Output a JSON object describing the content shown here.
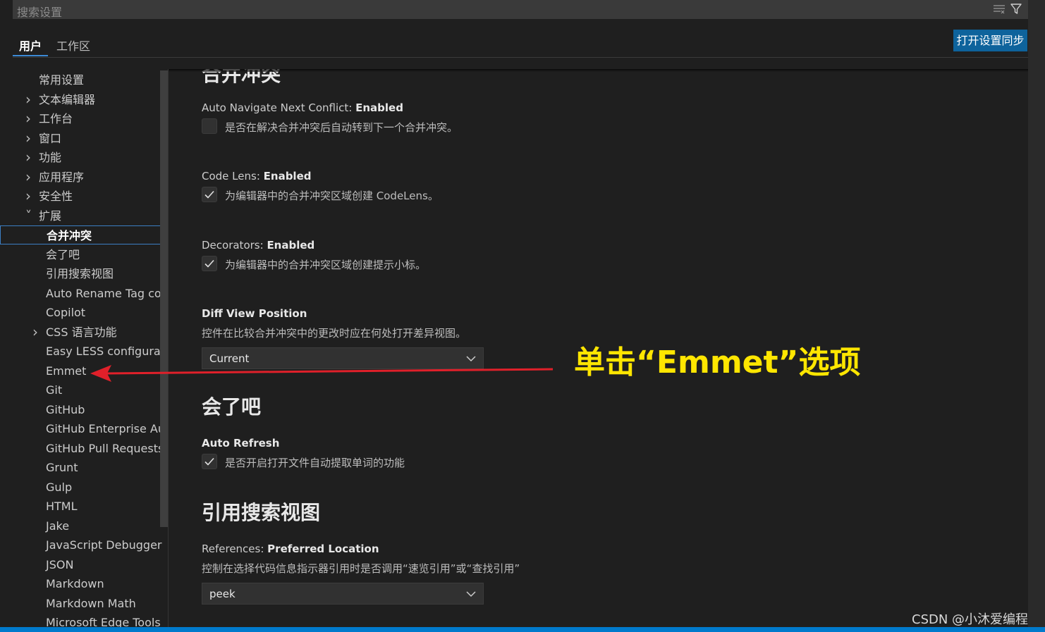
{
  "search": {
    "placeholder": "搜索设置"
  },
  "tabs": [
    {
      "label": "用户",
      "active": true
    },
    {
      "label": "工作区",
      "active": false
    }
  ],
  "sync_button": "打开设置同步",
  "sidebar": {
    "items": [
      {
        "label": "常用设置",
        "chevron": ""
      },
      {
        "label": "文本编辑器",
        "chevron": "right"
      },
      {
        "label": "工作台",
        "chevron": "right"
      },
      {
        "label": "窗口",
        "chevron": "right"
      },
      {
        "label": "功能",
        "chevron": "right"
      },
      {
        "label": "应用程序",
        "chevron": "right"
      },
      {
        "label": "安全性",
        "chevron": "right"
      },
      {
        "label": "扩展",
        "chevron": "down"
      },
      {
        "label": "合并冲突",
        "chevron": "",
        "selected": true
      },
      {
        "label": "会了吧",
        "chevron": ""
      },
      {
        "label": "引用搜索视图",
        "chevron": ""
      },
      {
        "label": "Auto Rename Tag con...",
        "chevron": ""
      },
      {
        "label": "Copilot",
        "chevron": ""
      },
      {
        "label": "CSS 语言功能",
        "chevron": "right"
      },
      {
        "label": "Easy LESS configuration",
        "chevron": ""
      },
      {
        "label": "Emmet",
        "chevron": ""
      },
      {
        "label": "Git",
        "chevron": ""
      },
      {
        "label": "GitHub",
        "chevron": ""
      },
      {
        "label": "GitHub Enterprise Aut...",
        "chevron": ""
      },
      {
        "label": "GitHub Pull Requests",
        "chevron": ""
      },
      {
        "label": "Grunt",
        "chevron": ""
      },
      {
        "label": "Gulp",
        "chevron": ""
      },
      {
        "label": "HTML",
        "chevron": ""
      },
      {
        "label": "Jake",
        "chevron": ""
      },
      {
        "label": "JavaScript Debugger",
        "chevron": ""
      },
      {
        "label": "JSON",
        "chevron": ""
      },
      {
        "label": "Markdown",
        "chevron": ""
      },
      {
        "label": "Markdown Math",
        "chevron": ""
      },
      {
        "label": "Microsoft Edge Tools",
        "chevron": ""
      }
    ]
  },
  "content": {
    "section_merge": "合并冲突",
    "auto_nav": {
      "prefix": "Auto Navigate Next Conflict: ",
      "name": "Enabled",
      "desc": "是否在解决合并冲突后自动转到下一个合并冲突。",
      "checked": false
    },
    "code_lens": {
      "prefix": "Code Lens: ",
      "name": "Enabled",
      "desc": "为编辑器中的合并冲突区域创建 CodeLens。",
      "checked": true
    },
    "decorators": {
      "prefix": "Decorators: ",
      "name": "Enabled",
      "desc": "为编辑器中的合并冲突区域创建提示小标。",
      "checked": true
    },
    "diff_view": {
      "name": "Diff View Position",
      "desc": "控件在比较合并冲突中的更改时应在何处打开差异视图。",
      "value": "Current"
    },
    "section_huileba": "会了吧",
    "auto_refresh": {
      "name": "Auto Refresh",
      "desc": "是否开启打开文件自动提取单词的功能",
      "checked": true
    },
    "section_refs": "引用搜索视图",
    "references": {
      "prefix": "References: ",
      "name": "Preferred Location",
      "desc": "控制在选择代码信息指示器引用时是否调用“速览引用”或“查找引用”",
      "value": "peek"
    }
  },
  "annotation": "单击“Emmet”选项",
  "watermark": "CSDN @小沐爱编程",
  "colors": {
    "accent": "#0e639c",
    "annotation": "#ffe600",
    "arrow": "#e0202a",
    "status_bar": "#007acc"
  }
}
